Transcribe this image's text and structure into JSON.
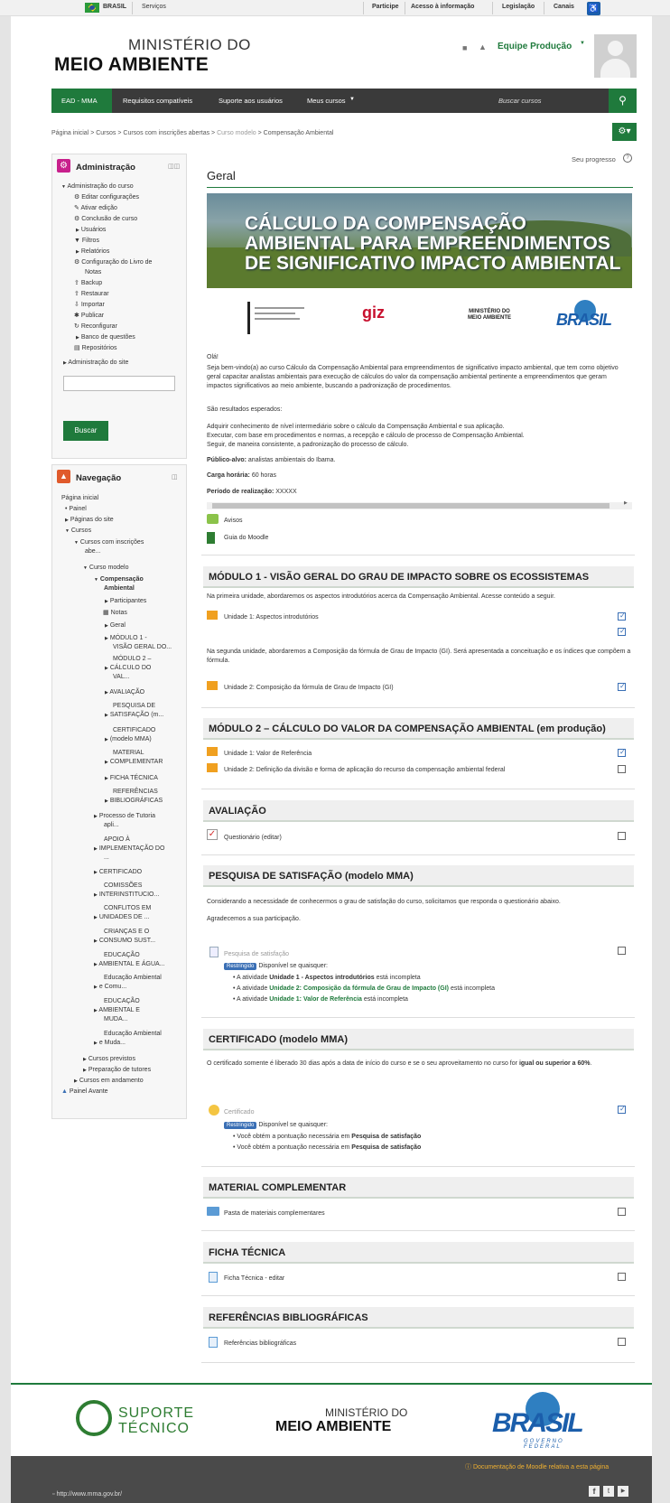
{
  "gov_bar": {
    "brasil": "BRASIL",
    "servicos": "Serviços",
    "participe": "Participe",
    "acesso": "Acesso à informação",
    "legislacao": "Legislação",
    "canais": "Canais"
  },
  "header": {
    "title_line1": "MINISTÉRIO DO",
    "title_line2": "MEIO AMBIENTE",
    "user_name": "Equipe Produção"
  },
  "nav": {
    "items": [
      "EAD - MMA",
      "Requisitos compatíveis",
      "Suporte aos usuários",
      "Meus cursos"
    ],
    "search_placeholder": "Buscar cursos"
  },
  "breadcrumb": [
    "Página inicial",
    "Cursos",
    "Cursos com inscrições abertas",
    "Curso modelo",
    "Compensação Ambiental"
  ],
  "admin_block": {
    "title": "Administração",
    "items": [
      "Administração do curso",
      "Editar configurações",
      "Ativar edição",
      "Conclusão de curso",
      "Usuários",
      "Filtros",
      "Relatórios",
      "Configuração do Livro de",
      "Notas",
      "Backup",
      "Restaurar",
      "Importar",
      "Publicar",
      "Reconfigurar",
      "Banco de questões",
      "Repositórios",
      "Administração do site"
    ],
    "search_button": "Buscar"
  },
  "nav_block": {
    "title": "Navegação",
    "items": [
      "Página inicial",
      "Painel",
      "Páginas do site",
      "Cursos",
      "Cursos com inscrições",
      "abe...",
      "Curso modelo",
      "Compensação",
      "Ambiental",
      "Participantes",
      "Notas",
      "Geral",
      "MÓDULO 1 -",
      "VISÃO GERAL DO...",
      "MÓDULO 2 –",
      "CÁLCULO DO",
      "VAL...",
      "AVALIAÇÃO",
      "PESQUISA DE",
      "SATISFAÇÃO (m...",
      "CERTIFICADO",
      "(modelo MMA)",
      "MATERIAL",
      "COMPLEMENTAR",
      "FICHA TÉCNICA",
      "REFERÊNCIAS",
      "BIBLIOGRÁFICAS",
      "Processo de Tutoria",
      "apli...",
      "APOIO À",
      "IMPLEMENTAÇÃO DO",
      "...",
      "CERTIFICADO",
      "COMISSÕES",
      "INTERINSTITUCIO...",
      "CONFLITOS EM",
      "UNIDADES DE ...",
      "CRIANÇAS E O",
      "CONSUMO SUST...",
      "EDUCAÇÃO",
      "AMBIENTAL E ÁGUA...",
      "Educação Ambiental",
      "e Comu...",
      "EDUCAÇÃO",
      "AMBIENTAL E",
      "MUDA...",
      "Educação Ambiental",
      "e Muda...",
      "Cursos previstos",
      "Preparação de tutores",
      "Cursos em andamento",
      "Painel Avante"
    ]
  },
  "progress_label": "Seu progresso",
  "geral": {
    "title": "Geral",
    "banner_line1": "CÁLCULO DA COMPENSAÇÃO",
    "banner_line2": "AMBIENTAL PARA EMPREENDIMENTOS",
    "banner_line3": "DE SIGNIFICATIVO IMPACTO AMBIENTAL",
    "logo_giz": "giz",
    "logo_mma": "MINISTÉRIO DO MEIO AMBIENTE",
    "logo_brasil": "BRASIL",
    "hello": "Olá!",
    "intro": "Seja bem-vindo(a) ao curso Cálculo da Compensação Ambiental para empreendimentos de significativo impacto ambiental, que tem como objetivo geral capacitar analistas ambientais para execução de cálculos do valor da compensação ambiental pertinente a empreendimentos que geram impactos significativos ao meio ambiente, buscando a padronização de procedimentos.",
    "results_title": "São resultados esperados:",
    "result1": "Adquirir conhecimento de nível intermediário sobre o cálculo da Compensação Ambiental e sua aplicação.",
    "result2": "Executar, com base em procedimentos e normas, a recepção e cálculo de processo de Compensação Ambiental.",
    "result3": "Seguir, de maneira consistente, a padronização do processo de cálculo.",
    "publico_label": "Público-alvo:",
    "publico_value": "analistas ambientais do Ibama.",
    "carga_label": "Carga horária:",
    "carga_value": "60 horas",
    "periodo_label": "Período de realização:",
    "periodo_value": "XXXXX",
    "avisos": "Avisos",
    "guia": "Guia do Moodle"
  },
  "mod1": {
    "title": "MÓDULO 1 - VISÃO GERAL DO GRAU DE IMPACTO SOBRE OS ECOSSISTEMAS",
    "intro": "Na primeira unidade, abordaremos os aspectos introdutórios acerca da Compensação Ambiental. Acesse conteúdo a seguir.",
    "unit1": "Unidade 1: Aspectos introdutórios",
    "text2": "Na segunda unidade, abordaremos a Composição da fórmula de Grau de Impacto (GI). Será apresentada a conceituação e os índices que compõem a fórmula.",
    "unit2": "Unidade 2: Composição da fórmula de Grau de Impacto (GI)"
  },
  "mod2": {
    "title": "MÓDULO 2 – CÁLCULO DO VALOR DA COMPENSAÇÃO AMBIENTAL (em produção)",
    "unit1": "Unidade 1: Valor de Referência",
    "unit2": "Unidade 2: Definição da divisão e forma de aplicação do recurso da compensação ambiental federal"
  },
  "avaliacao": {
    "title": "AVALIAÇÃO",
    "item": "Questionário (editar)"
  },
  "pesquisa": {
    "title": "PESQUISA DE SATISFAÇÃO (modelo MMA)",
    "text1": "Considerando a necessidade de conhecermos o grau de satisfação do curso, solicitamos que responda o questionário abaixo.",
    "text2": "Agradecemos a sua participação.",
    "item": "Pesquisa de satisfação",
    "restr_badge": "Restringido",
    "restr_text": "Disponível se quaisquer:",
    "cond_prefix": "A atividade",
    "cond_suffix": "está incompleta",
    "cond1": "Unidade 1 - Aspectos introdutórios",
    "cond2": "Unidade 2: Composição da fórmula de Grau de Impacto (GI)",
    "cond3": "Unidade 1: Valor de Referência"
  },
  "certificado": {
    "title": "CERTIFICADO (modelo MMA)",
    "text_a": "O certificado somente é liberado 30 dias após a data de início do curso e se o seu aproveitamento no curso for",
    "text_bold1": "igual ou",
    "text_bold2": "superior a 60%",
    "item": "Certificado",
    "restr_badge": "Restringido",
    "restr_text": "Disponível se quaisquer:",
    "cond_prefix": "Você obtém a pontuação necessária em",
    "cond_bold": "Pesquisa de satisfação"
  },
  "material": {
    "title": "MATERIAL COMPLEMENTAR",
    "item": "Pasta de materiais complementares"
  },
  "ficha": {
    "title": "FICHA TÉCNICA",
    "item": "Ficha Técnica - editar"
  },
  "referencias": {
    "title": "REFERÊNCIAS BIBLIOGRÁFICAS",
    "item": "Referências bibliográficas"
  },
  "footer": {
    "suporte1": "SUPORTE",
    "suporte2": "TÉCNICO",
    "mma1": "MINISTÉRIO DO",
    "mma2": "MEIO AMBIENTE",
    "brasil": "BRASIL",
    "brasil_sub": "GOVERNO FEDERAL",
    "url": "http://www.mma.gov.br/",
    "doc_link": "Documentação de Moodle relativa a esta página"
  },
  "colors": {
    "accent_green": "#1f7a3c",
    "nav_dark": "#3a3a3a",
    "badge_blue": "#3a6fb5"
  }
}
